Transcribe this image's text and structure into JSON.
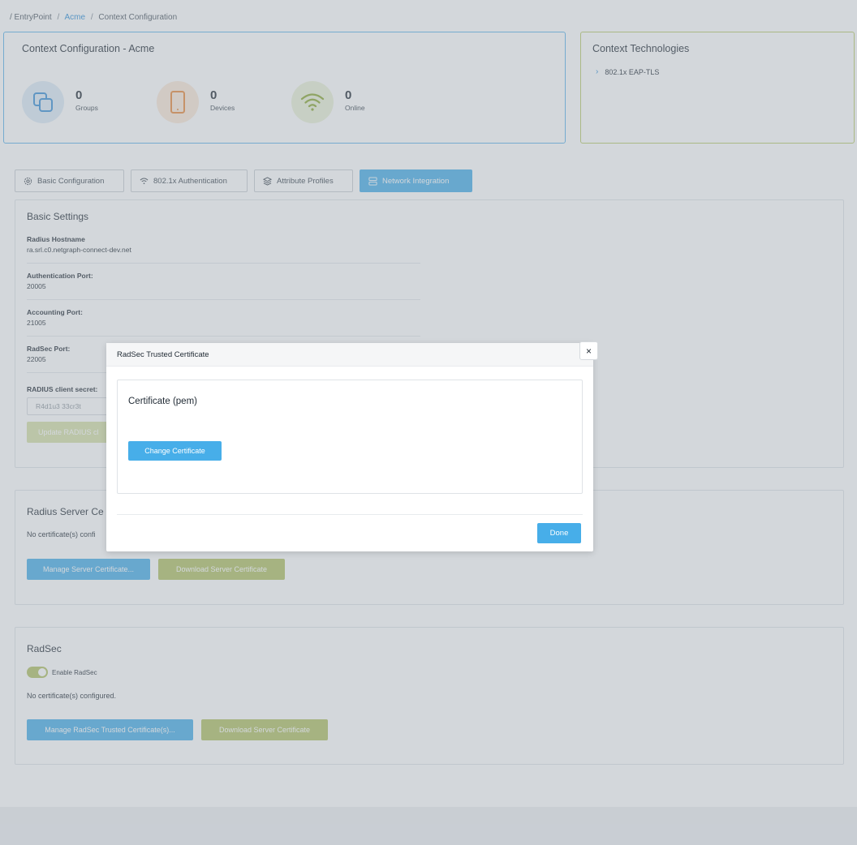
{
  "breadcrumb": {
    "root": "/ EntryPoint",
    "sep": "/",
    "tenant": "Acme",
    "current": "Context Configuration"
  },
  "summary": {
    "title": "Context Configuration - Acme",
    "stats": [
      {
        "value": "0",
        "label": "Groups",
        "icon": "copy-icon",
        "color": "#3a8fd6",
        "bg": "#dceaf6"
      },
      {
        "value": "0",
        "label": "Devices",
        "icon": "tablet-icon",
        "color": "#e8893a",
        "bg": "#fbe8d8"
      },
      {
        "value": "0",
        "label": "Online",
        "icon": "wifi-icon",
        "color": "#8aa832",
        "bg": "#ebf1d8"
      }
    ]
  },
  "technologies": {
    "title": "Context Technologies",
    "items": [
      "802.1x EAP-TLS"
    ]
  },
  "tabs": [
    {
      "label": "Basic Configuration",
      "icon": "gear-icon"
    },
    {
      "label": "802.1x Authentication",
      "icon": "wifi-icon"
    },
    {
      "label": "Attribute Profiles",
      "icon": "layers-icon"
    },
    {
      "label": "Network Integration",
      "icon": "server-icon",
      "active": true
    }
  ],
  "basic": {
    "title": "Basic Settings",
    "fields": [
      {
        "label": "Radius Hostname",
        "value": "ra.srl.c0.netgraph-connect-dev.net"
      },
      {
        "label": "Authentication Port:",
        "value": "20005"
      },
      {
        "label": "Accounting Port:",
        "value": "21005"
      },
      {
        "label": "RadSec Port:",
        "value": "22005"
      }
    ],
    "secret_label": "RADIUS client secret:",
    "secret_value": "R4d1u3 33cr3t",
    "update_button": "Update RADIUS cl"
  },
  "radius_server": {
    "title": "Radius Server Ce",
    "status": "No certificate(s) confi",
    "manage_button": "Manage Server Certificate...",
    "download_button": "Download Server Certificate"
  },
  "radsec": {
    "title": "RadSec",
    "toggle_label": "Enable RadSec",
    "status": "No certificate(s) configured.",
    "manage_button": "Manage RadSec Trusted Certificate(s)...",
    "download_button": "Download Server Certificate"
  },
  "modal": {
    "title": "RadSec Trusted Certificate",
    "close": "×",
    "cert_title": "Certificate (pem)",
    "change_button": "Change Certificate",
    "done_button": "Done"
  }
}
